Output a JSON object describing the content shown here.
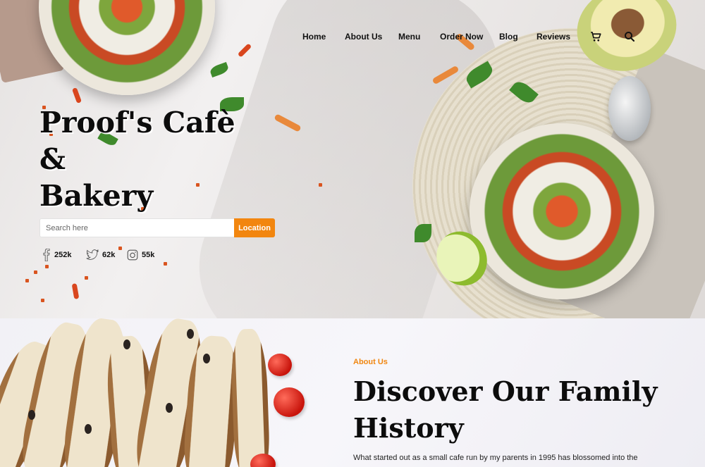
{
  "nav": {
    "items": [
      {
        "label": "Home"
      },
      {
        "label": "About Us"
      },
      {
        "label": "Menu"
      },
      {
        "label": "Order Now"
      },
      {
        "label": "Blog"
      },
      {
        "label": "Reviews"
      }
    ],
    "cart_icon": "cart-icon",
    "search_icon": "search-icon"
  },
  "hero": {
    "title_line1": "Proof's Cafè",
    "title_line2": "&",
    "title_line3": "Bakery",
    "search_placeholder": "Search here",
    "search_button": "Location",
    "social": [
      {
        "icon": "facebook-icon",
        "count": "252k"
      },
      {
        "icon": "twitter-icon",
        "count": "62k"
      },
      {
        "icon": "instagram-icon",
        "count": "55k"
      }
    ]
  },
  "about": {
    "eyebrow": "About Us",
    "heading": "Discover Our Family History",
    "text": "What started out as a small cafe run by my parents in 1995 has blossomed into the"
  },
  "colors": {
    "accent": "#f2860f",
    "text": "#0c0c0c"
  }
}
